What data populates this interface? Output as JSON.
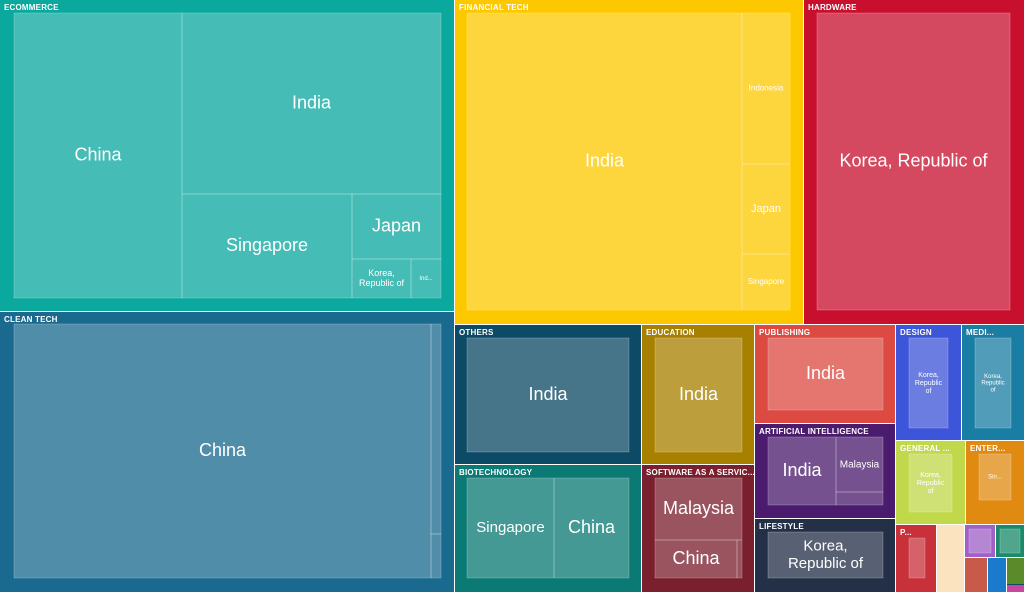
{
  "chart_data": {
    "type": "treemap",
    "groups": [
      {
        "name": "ECOMMERCE",
        "display": "ECOMMERCE",
        "color": "#0ba89e",
        "children": [
          {
            "name": "China",
            "display": "China"
          },
          {
            "name": "India",
            "display": "India"
          },
          {
            "name": "Singapore",
            "display": "Singapore"
          },
          {
            "name": "Japan",
            "display": "Japan"
          },
          {
            "name": "Korea, Republic of",
            "display": "Korea, Republic of"
          },
          {
            "name": "Ind...",
            "display": "Ind..."
          }
        ]
      },
      {
        "name": "FINANCIAL TECH",
        "display": "FINANCIAL TECH",
        "color": "#fdc800",
        "children": [
          {
            "name": "India",
            "display": "India"
          },
          {
            "name": "Indonesia",
            "display": "Indonesia"
          },
          {
            "name": "Japan",
            "display": "Japan"
          },
          {
            "name": "Singapore",
            "display": "Singapore"
          }
        ]
      },
      {
        "name": "HARDWARE",
        "display": "HARDWARE",
        "color": "#c8102e",
        "children": [
          {
            "name": "Korea, Republic of",
            "display": "Korea, Republic of"
          }
        ]
      },
      {
        "name": "CLEAN TECH",
        "display": "CLEAN TECH",
        "color": "#1a6a8f",
        "children": [
          {
            "name": "China",
            "display": "China"
          },
          {
            "name": "",
            "display": ""
          },
          {
            "name": "",
            "display": ""
          }
        ]
      },
      {
        "name": "OTHERS",
        "display": "OTHERS",
        "color": "#0d4a66",
        "children": [
          {
            "name": "India",
            "display": "India"
          }
        ]
      },
      {
        "name": "EDUCATION",
        "display": "EDUCATION",
        "color": "#a88000",
        "children": [
          {
            "name": "India",
            "display": "India"
          }
        ]
      },
      {
        "name": "PUBLISHING",
        "display": "PUBLISHING",
        "color": "#dc4a42",
        "children": [
          {
            "name": "India",
            "display": "India"
          }
        ]
      },
      {
        "name": "BIOTECHNOLOGY",
        "display": "BIOTECHNOLOGY",
        "color": "#0b7a74",
        "children": [
          {
            "name": "Singapore",
            "display": "Singapore"
          },
          {
            "name": "China",
            "display": "China"
          }
        ]
      },
      {
        "name": "ARTIFICIAL INTELLIGENCE",
        "display": "ARTIFICIAL INTELLIGENCE",
        "color": "#4b1b6e",
        "children": [
          {
            "name": "India",
            "display": "India"
          },
          {
            "name": "Malaysia",
            "display": "Malaysia"
          },
          {
            "name": "",
            "display": ""
          }
        ]
      },
      {
        "name": "SOFTWARE AS A SERVICE",
        "display": "SOFTWARE AS A SERVIC...",
        "color": "#7a1f2e",
        "children": [
          {
            "name": "Malaysia",
            "display": "Malaysia"
          },
          {
            "name": "China",
            "display": "China"
          },
          {
            "name": "",
            "display": ""
          }
        ]
      },
      {
        "name": "LIFESTYLE",
        "display": "LIFESTYLE",
        "color": "#243047",
        "children": [
          {
            "name": "Korea, Republic of",
            "display": "Korea, Republic of"
          }
        ]
      },
      {
        "name": "DESIGN",
        "display": "DESIGN",
        "color": "#3d55d8",
        "children": [
          {
            "name": "Korea, Republic of",
            "display": "Korea, Republic of"
          }
        ]
      },
      {
        "name": "MEDI...",
        "display": "MEDI...",
        "color": "#1a7da3",
        "children": [
          {
            "name": "Korea, Republic of",
            "display": "Korea, Republic of"
          }
        ]
      },
      {
        "name": "GENERAL ...",
        "display": "GENERAL ...",
        "color": "#c0d84a",
        "children": [
          {
            "name": "Korea, Republic of",
            "display": "Korea, Republic of"
          }
        ]
      },
      {
        "name": "ENTER...",
        "display": "ENTER...",
        "color": "#e08a12",
        "children": [
          {
            "name": "Sin...",
            "display": "Sin..."
          }
        ]
      },
      {
        "name": "P...",
        "display": "P...",
        "color": "#c8303a",
        "children": [
          {
            "name": "",
            "display": ""
          }
        ]
      },
      {
        "name": "",
        "display": "",
        "color": "#fbe3c0",
        "children": []
      },
      {
        "name": "",
        "display": "",
        "color": "#a060c8",
        "children": [
          {
            "name": "",
            "display": ""
          }
        ]
      },
      {
        "name": "",
        "display": "",
        "color": "#1a8a6a",
        "children": [
          {
            "name": "",
            "display": ""
          }
        ]
      },
      {
        "name": "",
        "display": "",
        "color": "#c85a4a",
        "children": []
      },
      {
        "name": "",
        "display": "",
        "color": "#1a7acc",
        "children": []
      },
      {
        "name": "",
        "display": "",
        "color": "#0d4a66",
        "children": []
      },
      {
        "name": "",
        "display": "",
        "color": "#5a8a2a",
        "children": []
      },
      {
        "name": "",
        "display": "",
        "color": "#c848a0",
        "children": []
      }
    ]
  }
}
